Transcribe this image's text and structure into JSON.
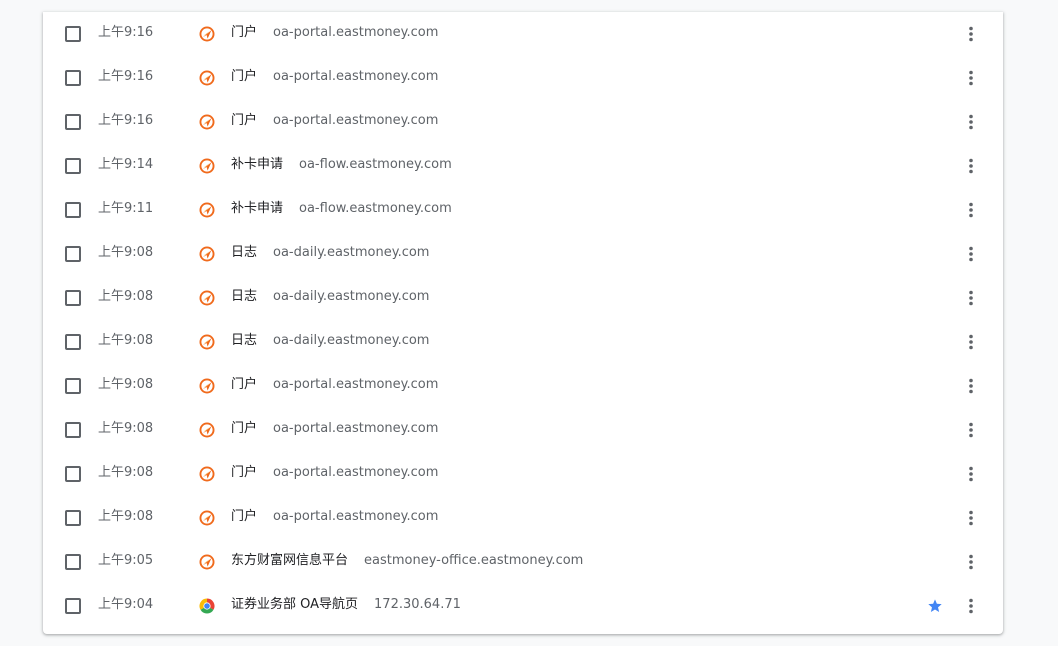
{
  "history": {
    "items": [
      {
        "time": "上午9:16",
        "title": "门户",
        "domain": "oa-portal.eastmoney.com",
        "favicon": "eastmoney-icon",
        "starred": false
      },
      {
        "time": "上午9:16",
        "title": "门户",
        "domain": "oa-portal.eastmoney.com",
        "favicon": "eastmoney-icon",
        "starred": false
      },
      {
        "time": "上午9:16",
        "title": "门户",
        "domain": "oa-portal.eastmoney.com",
        "favicon": "eastmoney-icon",
        "starred": false
      },
      {
        "time": "上午9:14",
        "title": "补卡申请",
        "domain": "oa-flow.eastmoney.com",
        "favicon": "eastmoney-icon",
        "starred": false
      },
      {
        "time": "上午9:11",
        "title": "补卡申请",
        "domain": "oa-flow.eastmoney.com",
        "favicon": "eastmoney-icon",
        "starred": false
      },
      {
        "time": "上午9:08",
        "title": "日志",
        "domain": "oa-daily.eastmoney.com",
        "favicon": "eastmoney-icon",
        "starred": false
      },
      {
        "time": "上午9:08",
        "title": "日志",
        "domain": "oa-daily.eastmoney.com",
        "favicon": "eastmoney-icon",
        "starred": false
      },
      {
        "time": "上午9:08",
        "title": "日志",
        "domain": "oa-daily.eastmoney.com",
        "favicon": "eastmoney-icon",
        "starred": false
      },
      {
        "time": "上午9:08",
        "title": "门户",
        "domain": "oa-portal.eastmoney.com",
        "favicon": "eastmoney-icon",
        "starred": false
      },
      {
        "time": "上午9:08",
        "title": "门户",
        "domain": "oa-portal.eastmoney.com",
        "favicon": "eastmoney-icon",
        "starred": false
      },
      {
        "time": "上午9:08",
        "title": "门户",
        "domain": "oa-portal.eastmoney.com",
        "favicon": "eastmoney-icon",
        "starred": false
      },
      {
        "time": "上午9:08",
        "title": "门户",
        "domain": "oa-portal.eastmoney.com",
        "favicon": "eastmoney-icon",
        "starred": false
      },
      {
        "time": "上午9:05",
        "title": "东方财富网信息平台",
        "domain": "eastmoney-office.eastmoney.com",
        "favicon": "eastmoney-icon",
        "starred": false
      },
      {
        "time": "上午9:04",
        "title": "证券业务部 OA导航页",
        "domain": "172.30.64.71",
        "favicon": "chrome-icon",
        "starred": true
      }
    ]
  },
  "colors": {
    "star": "#4285f4",
    "checkbox_border": "#5f6368",
    "eastmoney_outer": "#f06a1c",
    "eastmoney_inner": "#ffffff"
  }
}
